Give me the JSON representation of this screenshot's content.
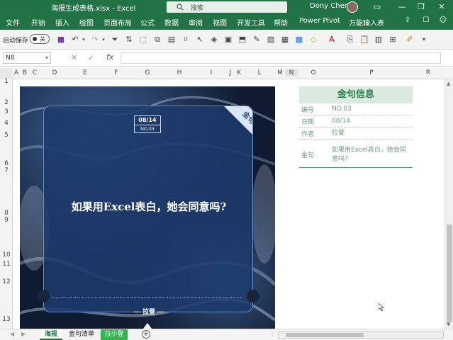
{
  "titlebar": {
    "title": "海报生成表格.xlsx  -  Excel",
    "search_placeholder": "搜索",
    "user": "Dony Chen",
    "minimize": "—",
    "restore": "❐",
    "close": "✕",
    "ribbon_display": "▭"
  },
  "menu": {
    "items": [
      "文件",
      "开始",
      "插入",
      "绘图",
      "页面布局",
      "公式",
      "数据",
      "审阅",
      "视图",
      "开发工具",
      "帮助",
      "Power Pivot",
      "万能输入表"
    ]
  },
  "toolbar": {
    "autosave_label": "自动保存",
    "autosave_state": "关"
  },
  "formulabar": {
    "namebox": "N8",
    "cancel": "✕",
    "enter": "✓",
    "fx": "fx",
    "content": ""
  },
  "columns": [
    "A",
    "B",
    "C",
    "D",
    "E",
    "F",
    "G",
    "H",
    "I",
    "J",
    "K",
    "L",
    "M",
    "N",
    "O",
    "P",
    "R"
  ],
  "rows": [
    "1",
    "2",
    "3",
    "4",
    "5",
    "6",
    "7",
    "8",
    "9",
    "10",
    "11",
    "12",
    "13"
  ],
  "poster": {
    "date": "08/14",
    "number": "NO.03",
    "corner_label": "金句",
    "quote": "如果用Excel表白，她会同意吗?",
    "author": "— 拉登 —"
  },
  "info": {
    "header": "金句信息",
    "rows": [
      {
        "key": "编号",
        "value": "NO.03"
      },
      {
        "key": "日期",
        "value": "08/14"
      },
      {
        "key": "作者",
        "value": "拉登"
      },
      {
        "key": "金句",
        "value": "如果用Excel表白，她会同意吗?"
      }
    ]
  },
  "sheets": {
    "tabs": [
      "海报",
      "金句清单",
      "拉小登"
    ],
    "add": "+"
  },
  "colors": {
    "excel_green": "#217346",
    "info_header_bg": "#d9ebdf",
    "info_header_text": "#2e7d4d",
    "poster_card": "#1c3a6c",
    "sheet_tab_green": "#2db84a"
  }
}
